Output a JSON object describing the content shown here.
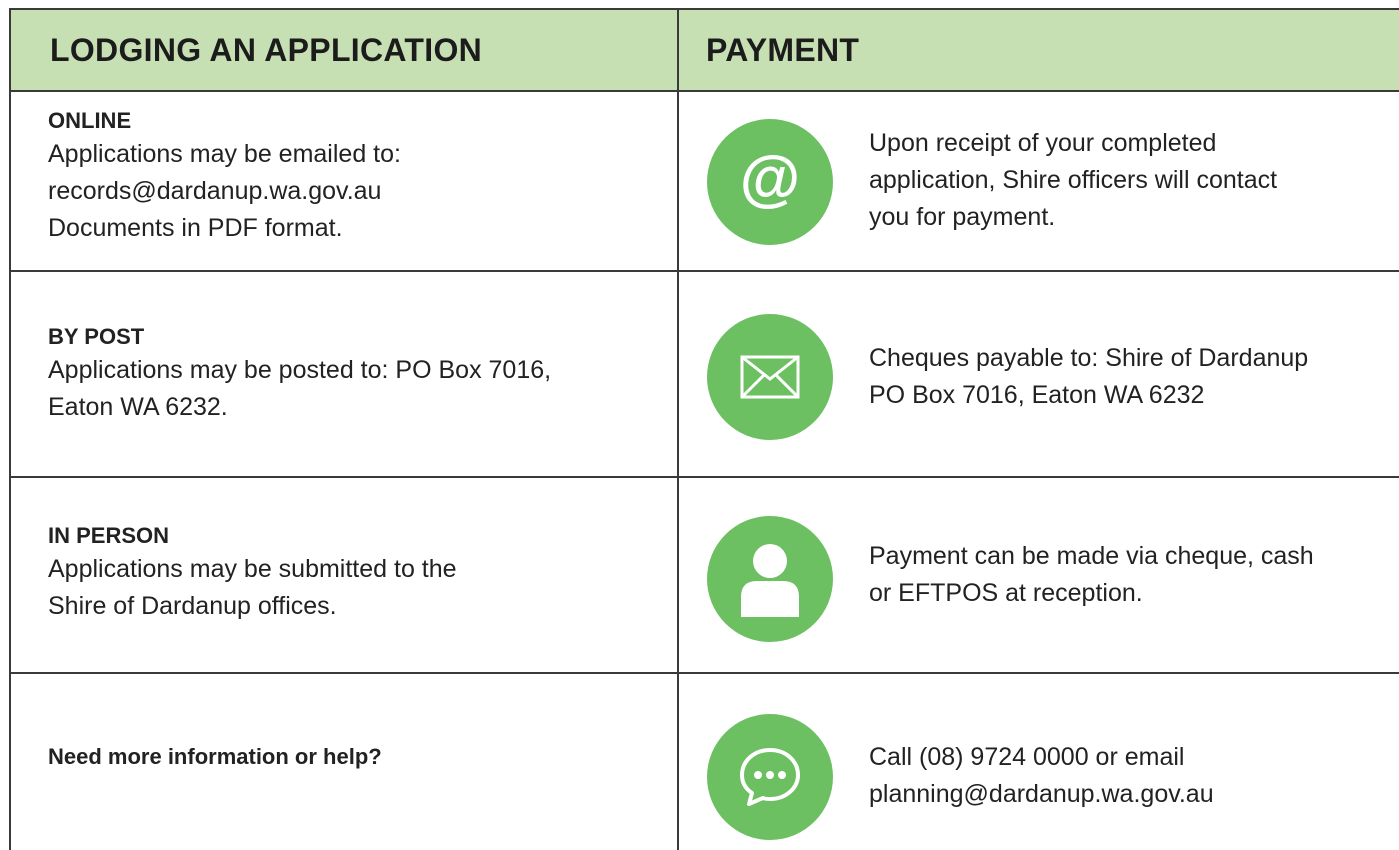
{
  "header": {
    "left": "LODGING AN APPLICATION",
    "right": "PAYMENT"
  },
  "rows": [
    {
      "title": "ONLINE",
      "left_lines": [
        "Applications may be emailed to:",
        "records@dardanup.wa.gov.au",
        "Documents in PDF format."
      ],
      "icon": "at-icon",
      "right_lines": [
        "Upon receipt of your completed",
        "application, Shire officers will contact",
        "you for payment."
      ]
    },
    {
      "title": "BY POST",
      "left_lines": [
        "Applications may be posted to: PO Box 7016,",
        "Eaton WA 6232."
      ],
      "icon": "envelope-icon",
      "right_lines": [
        "Cheques payable to: Shire of Dardanup",
        "PO Box 7016, Eaton WA 6232"
      ]
    },
    {
      "title": "IN PERSON",
      "left_lines": [
        "Applications may be submitted to the",
        "Shire of Dardanup offices."
      ],
      "icon": "person-icon",
      "right_lines": [
        "Payment can be made via cheque, cash",
        "or EFTPOS at reception."
      ]
    },
    {
      "title": "Need more information or help?",
      "left_lines": [],
      "icon": "chat-icon",
      "right_lines": [
        "Call (08) 9724 0000 or email",
        "planning@dardanup.wa.gov.au"
      ]
    }
  ],
  "colors": {
    "header_bg": "#c6e0b4",
    "icon_green": "#6cc062",
    "border": "#3a3a3a"
  }
}
